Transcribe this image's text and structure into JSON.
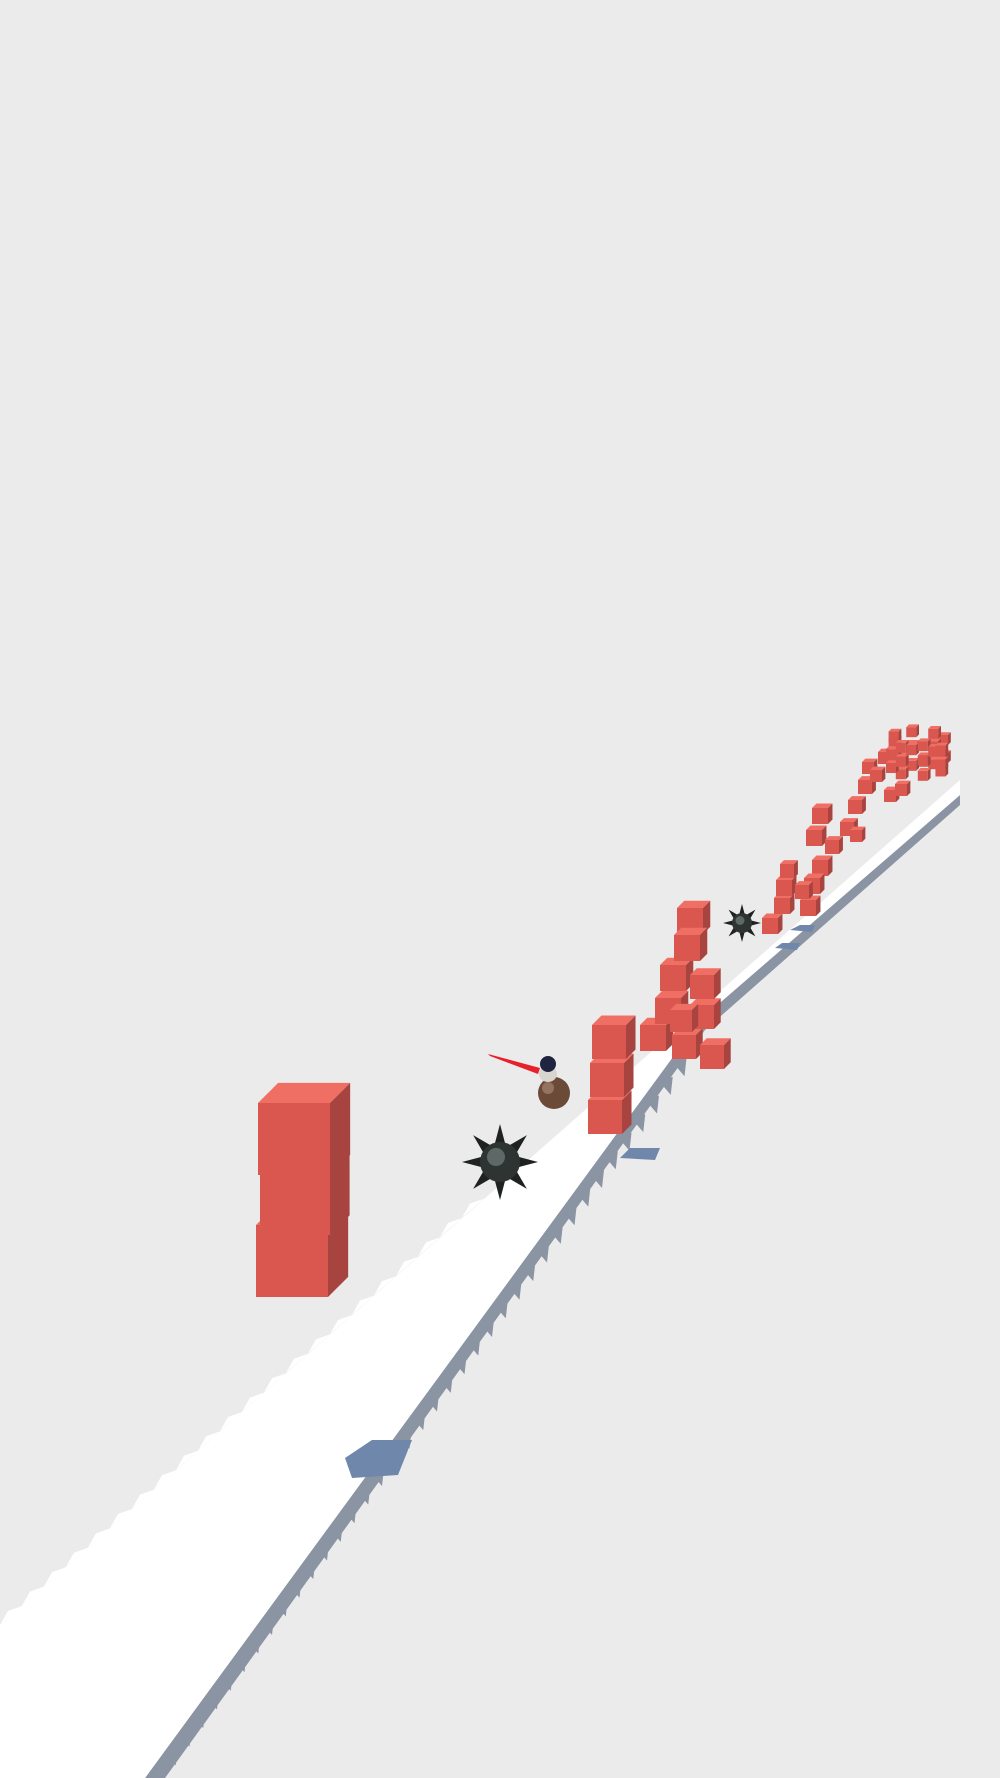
{
  "scene": {
    "background_color": "#ECEBEC",
    "track_color": "#FFFFFF",
    "track_side_color": "#8A94A2",
    "track_shadow_color": "#6F87AA",
    "block_colors": {
      "front": "#D9574F",
      "top": "#EF6F65",
      "side": "#A8443F"
    },
    "spike_ball_color": "#2E3432",
    "player": {
      "icon": "ball-rider-icon",
      "trail_color": "#E8202A",
      "ball_color": "#6B4A38",
      "head_color": "#1F2440"
    },
    "obstacles": [
      {
        "type": "block-stack",
        "icon": "red-cube-stack-icon",
        "count": 3
      },
      {
        "type": "spiked-mine",
        "icon": "spiked-mine-icon"
      },
      {
        "type": "block-stack",
        "icon": "red-cube-stack-icon",
        "count": 3
      },
      {
        "type": "block-cluster",
        "icon": "red-cube-cluster-icon"
      },
      {
        "type": "spiked-mine",
        "icon": "spiked-mine-icon"
      },
      {
        "type": "block-cluster",
        "icon": "red-cube-cluster-icon"
      },
      {
        "type": "block-ring",
        "icon": "red-cube-ring-icon"
      }
    ]
  }
}
